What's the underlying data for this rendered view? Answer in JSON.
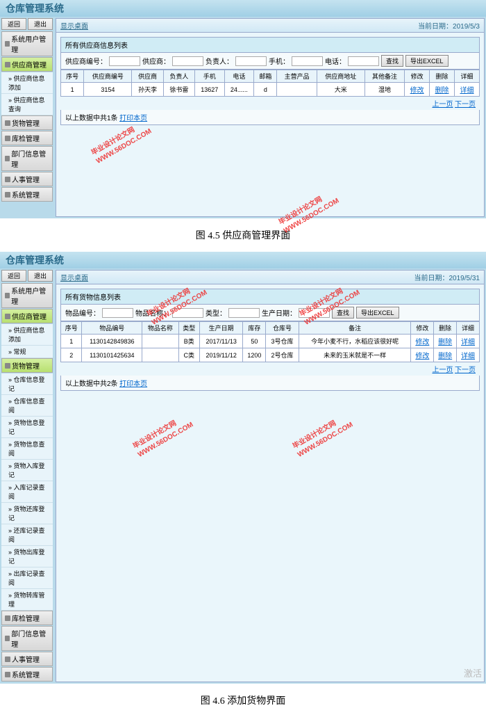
{
  "app1": {
    "title": "仓库管理系统",
    "crumb": "显示桌面",
    "date_label": "当前日期：2019/5/3",
    "sidebar": {
      "back": "返回",
      "exit": "退出",
      "groups": [
        {
          "label": "系统用户管理",
          "icon": "user"
        },
        {
          "label": "供应商管理",
          "icon": "box",
          "active": true,
          "items": [
            {
              "label": "供应商信息添加"
            },
            {
              "label": "供应商信息查询"
            }
          ]
        },
        {
          "label": "货物管理",
          "icon": "pkg"
        },
        {
          "label": "库检管理",
          "icon": "chk"
        },
        {
          "label": "部门信息管理",
          "icon": "dept"
        },
        {
          "label": "人事管理",
          "icon": "hr"
        },
        {
          "label": "系统管理",
          "icon": "sys"
        }
      ]
    },
    "panel_title": "所有供应商信息列表",
    "search": {
      "fields": [
        {
          "label": "供应商编号：",
          "value": ""
        },
        {
          "label": "供应商：",
          "value": ""
        },
        {
          "label": "负责人：",
          "value": ""
        },
        {
          "label": "手机：",
          "value": ""
        },
        {
          "label": "电话：",
          "value": ""
        }
      ],
      "btn_search": "查找",
      "btn_export": "导出EXCEL"
    },
    "table": {
      "headers": [
        "序号",
        "供应商编号",
        "供应商",
        "负责人",
        "手机",
        "电话",
        "邮箱",
        "主营产品",
        "供应商地址",
        "其他备注",
        "修改",
        "删除",
        "详细"
      ],
      "rows": [
        {
          "c": [
            "1",
            "3154",
            "孙天李",
            "徐书雷",
            "13627",
            "24......",
            "d",
            "",
            "大米",
            "湿地",
            "修改",
            "删除",
            "详细"
          ]
        }
      ]
    },
    "footer": "以上数据中共1条",
    "footer_link": "打印本页",
    "pager": {
      "prev": "上一页",
      "next": "下一页"
    }
  },
  "caption1": "图 4.5 供应商管理界面",
  "app2": {
    "title": "仓库管理系统",
    "crumb": "显示桌面",
    "date_label": "当前日期：2019/5/31",
    "sidebar": {
      "back": "返回",
      "exit": "退出",
      "groups": [
        {
          "label": "系统用户管理",
          "icon": "user"
        },
        {
          "label": "供应商管理",
          "icon": "box",
          "active": true,
          "items": [
            {
              "label": "供应商信息添加"
            },
            {
              "label": "常规"
            }
          ]
        },
        {
          "label": "货物管理",
          "icon": "pkg",
          "active": true,
          "items": [
            {
              "label": "仓库信息登记"
            },
            {
              "label": "仓库信息查阅"
            },
            {
              "label": "货物信息登记"
            },
            {
              "label": "货物信息查阅"
            },
            {
              "label": "货物入库登记"
            },
            {
              "label": "入库记录查阅"
            },
            {
              "label": "货物还库登记"
            },
            {
              "label": "还库记录查阅"
            },
            {
              "label": "货物出库登记"
            },
            {
              "label": "出库记录查阅"
            },
            {
              "label": "货物转库管理"
            }
          ]
        },
        {
          "label": "库检管理",
          "icon": "chk"
        },
        {
          "label": "部门信息管理",
          "icon": "dept"
        },
        {
          "label": "人事管理",
          "icon": "hr"
        },
        {
          "label": "系统管理",
          "icon": "sys"
        }
      ]
    },
    "panel_title": "所有货物信息列表",
    "search": {
      "fields": [
        {
          "label": "物品编号：",
          "value": ""
        },
        {
          "label": "物品名称：",
          "value": ""
        },
        {
          "label": "类型：",
          "value": ""
        },
        {
          "label": "生产日期：",
          "value": ""
        }
      ],
      "btn_search": "查找",
      "btn_export": "导出EXCEL"
    },
    "table": {
      "headers": [
        "序号",
        "物品编号",
        "物品名称",
        "类型",
        "生产日期",
        "库存",
        "仓库号",
        "备注",
        "修改",
        "删除",
        "详细"
      ],
      "rows": [
        {
          "c": [
            "1",
            "1130142849836",
            "",
            "B类",
            "2017/11/13",
            "50",
            "3号仓库",
            "今年小麦不行，水稻应该很好呢",
            "修改",
            "删除",
            "详细"
          ]
        },
        {
          "c": [
            "2",
            "1130101425634",
            "",
            "C类",
            "2019/11/12",
            "1200",
            "2号仓库",
            "未来的玉米就是不一样",
            "修改",
            "删除",
            "详细"
          ]
        }
      ]
    },
    "footer": "以上数据中共2条",
    "footer_link": "打印本页",
    "pager": {
      "prev": "上一页",
      "next": "下一页"
    }
  },
  "caption2": "图 4.6 添加货物界面",
  "watermark": {
    "line1": "毕业设计论文网",
    "line2": "WWW.56DOC.COM"
  },
  "activate": "激活"
}
